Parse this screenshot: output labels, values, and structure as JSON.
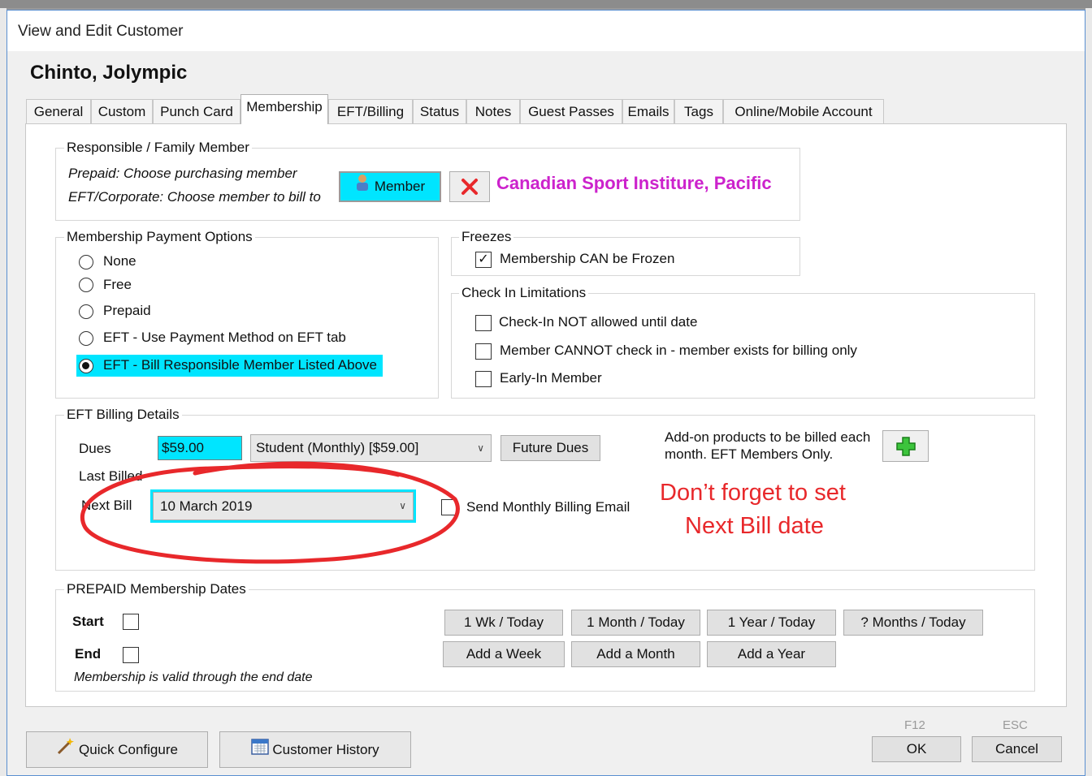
{
  "window": {
    "title": "View and Edit Customer",
    "customer_name": "Chinto, Jolympic"
  },
  "tabs": [
    "General",
    "Custom",
    "Punch Card",
    "Membership",
    "EFT/Billing",
    "Status",
    "Notes",
    "Guest Passes",
    "Emails",
    "Tags",
    "Online/Mobile Account"
  ],
  "active_tab": "Membership",
  "responsible": {
    "group_label": "Responsible / Family Member",
    "hint_line1": "Prepaid:  Choose purchasing member",
    "hint_line2": "EFT/Corporate: Choose member to bill to",
    "member_button": "Member",
    "member_name": "Canadian Sport Institure, Pacific"
  },
  "payment_options": {
    "group_label": "Membership Payment Options",
    "options": [
      "None",
      "Free",
      "Prepaid",
      "EFT - Use Payment Method on EFT tab",
      "EFT - Bill Responsible Member Listed Above"
    ],
    "selected": "EFT - Bill Responsible Member Listed Above"
  },
  "freezes": {
    "group_label": "Freezes",
    "can_freeze_label": "Membership CAN be Frozen",
    "can_freeze_checked": true
  },
  "checkin": {
    "group_label": "Check In Limitations",
    "items": [
      {
        "label": "Check-In NOT allowed until date",
        "checked": false
      },
      {
        "label": "Member CANNOT check in - member exists for billing only",
        "checked": false
      },
      {
        "label": "Early-In Member",
        "checked": false
      }
    ]
  },
  "eft_billing": {
    "group_label": "EFT Billing Details",
    "dues_label": "Dues",
    "dues_value": "$59.00",
    "plan_value": "Student (Monthly) [$59.00]",
    "future_dues_button": "Future Dues",
    "addon_text_line1": "Add-on products to be billed each",
    "addon_text_line2": "month. EFT Members Only.",
    "last_billed_label": "Last Billed",
    "next_bill_label": "Next Bill",
    "next_bill_value": "10 March 2019",
    "send_email_label": "Send Monthly Billing Email",
    "send_email_checked": false
  },
  "annotation": {
    "line1": "Don’t forget to set",
    "line2": "Next Bill date",
    "color": "#e8282b"
  },
  "prepaid": {
    "group_label": "PREPAID Membership Dates",
    "start_label": "Start",
    "end_label": "End",
    "note": "Membership is valid through the end date",
    "buttons_row1": [
      "1 Wk / Today",
      "1 Month / Today",
      "1 Year / Today",
      "? Months / Today"
    ],
    "buttons_row2": [
      "Add a Week",
      "Add a Month",
      "Add a Year"
    ]
  },
  "footer": {
    "quick_configure": "Quick Configure",
    "customer_history": "Customer History",
    "ok_key": "F12",
    "ok": "OK",
    "cancel_key": "ESC",
    "cancel": "Cancel"
  },
  "colors": {
    "highlight": "#00e5ff",
    "member_name": "#cc22cc",
    "annotation": "#e8282b"
  }
}
